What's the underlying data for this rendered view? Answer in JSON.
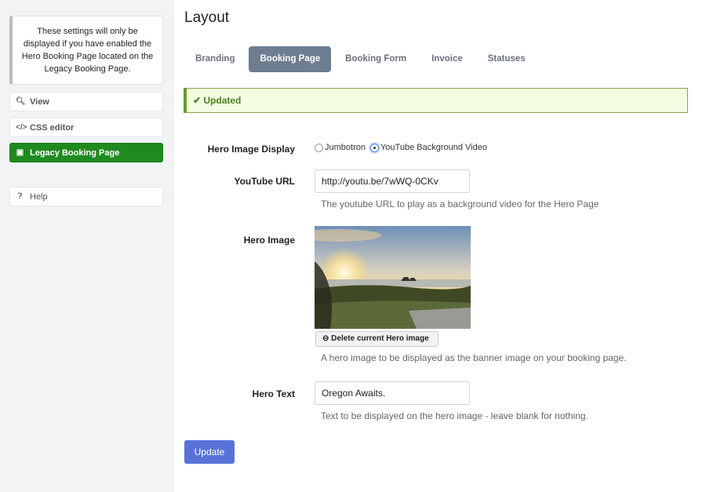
{
  "sidebar": {
    "note": "These settings will only be displayed if you have enabled the Hero Booking Page located on the Legacy Booking Page.",
    "items": [
      {
        "label": "View",
        "icon": "search-icon"
      },
      {
        "label": "CSS editor",
        "icon": "code-icon"
      },
      {
        "label": "Legacy Booking Page",
        "icon": "image-icon",
        "active": true
      },
      {
        "label": "Help",
        "icon": "question-circle-icon"
      }
    ]
  },
  "page": {
    "title": "Layout",
    "tabs": [
      "Branding",
      "Booking Page",
      "Booking Form",
      "Invoice",
      "Statuses"
    ],
    "active_tab": "Booking Page",
    "alert": "✔ Updated"
  },
  "form": {
    "hero_display": {
      "label": "Hero Image Display",
      "options": [
        "Jumbotron",
        "YouTube Background Video"
      ],
      "selected": "YouTube Background Video"
    },
    "youtube_url": {
      "label": "YouTube URL",
      "value": "http://youtu.be/7wWQ-0CKv",
      "help": "The youtube URL to play as a background video for the Hero Page"
    },
    "hero_image": {
      "label": "Hero Image",
      "delete_label": "Delete current Hero image",
      "help": "A hero image to be displayed as the banner image on your booking page."
    },
    "hero_text": {
      "label": "Hero Text",
      "value": "Oregon Awaits.",
      "help": "Text to be displayed on the hero image - leave blank for nothing."
    },
    "submit_label": "Update"
  }
}
